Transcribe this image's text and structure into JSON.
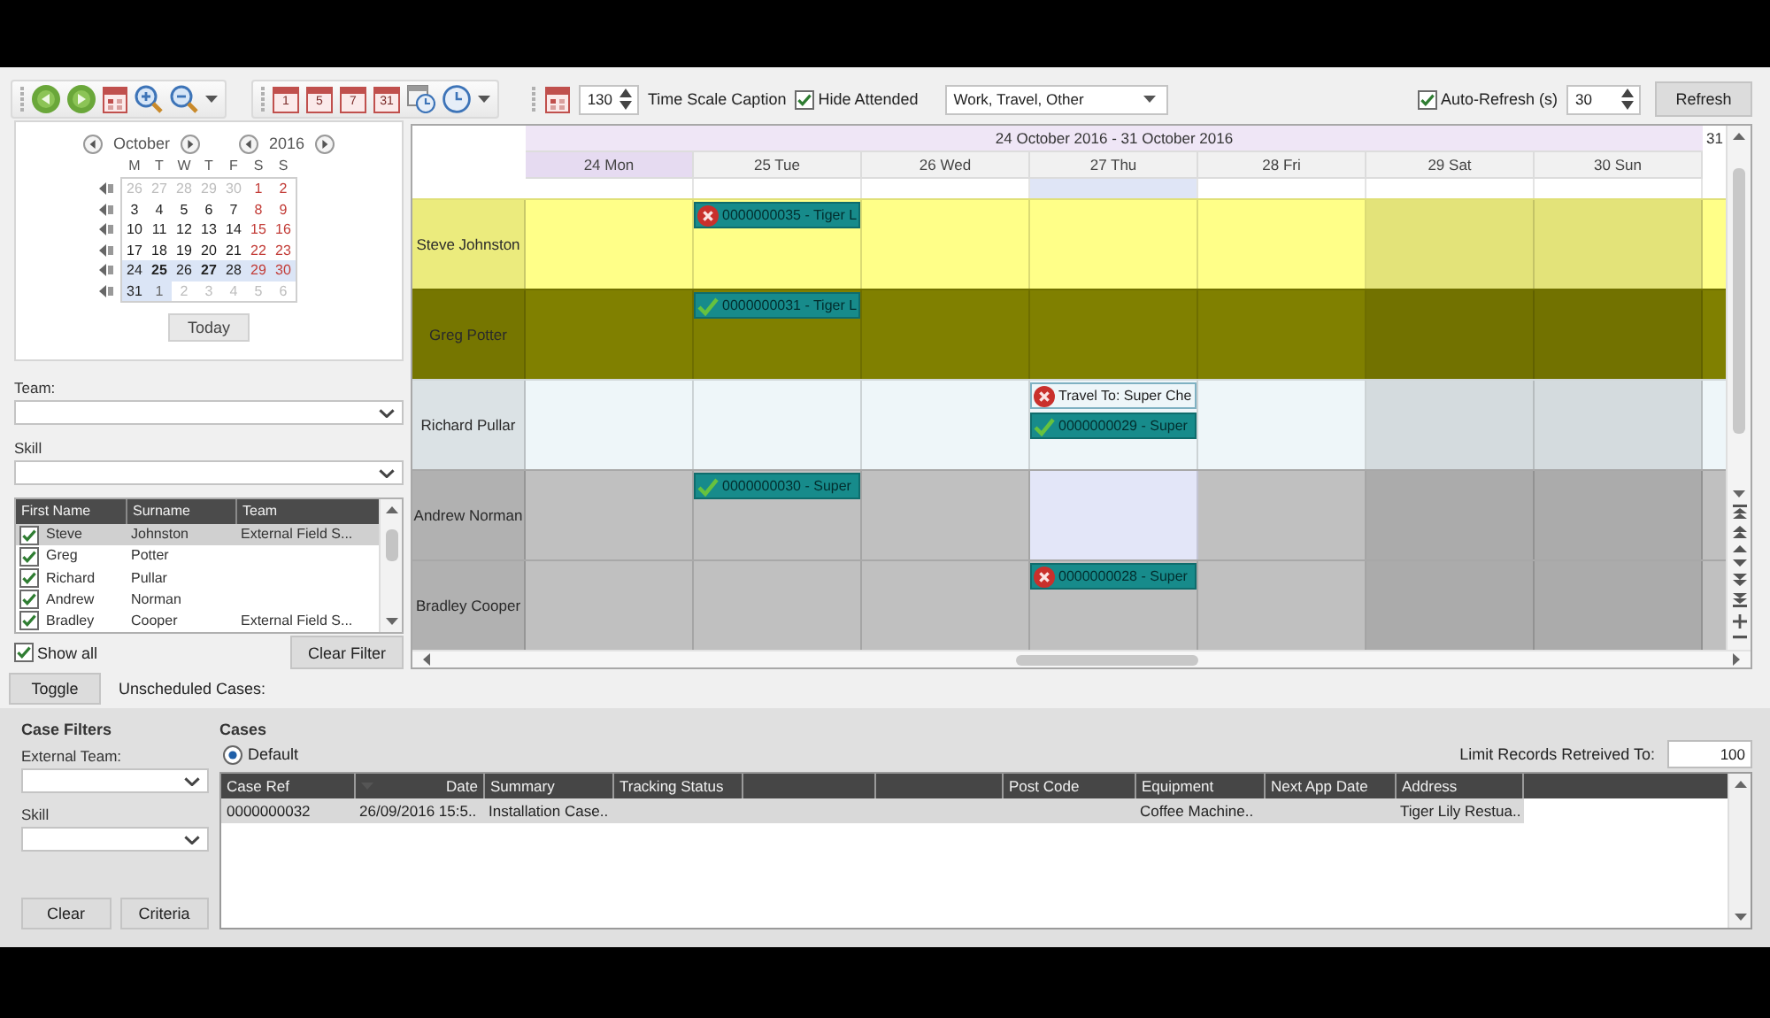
{
  "toolbar": {
    "view_buttons": [
      "1",
      "5",
      "7",
      "31"
    ],
    "scale": {
      "value": "130"
    },
    "time_scale_caption": "Time Scale Caption",
    "hide_attended": {
      "label": "Hide Attended",
      "checked": true
    },
    "appointment_types": {
      "value": "Work, Travel, Other"
    },
    "auto_refresh": {
      "label": "Auto-Refresh (s)",
      "checked": true
    },
    "refresh_interval": {
      "value": "30"
    },
    "refresh_button": "Refresh"
  },
  "calendar": {
    "month": "October",
    "year": "2016",
    "weekdays": [
      "M",
      "T",
      "W",
      "T",
      "F",
      "S",
      "S"
    ],
    "days": [
      {
        "text": "26",
        "kind": "other",
        "selected": false,
        "bold": false
      },
      {
        "text": "27",
        "kind": "other",
        "selected": false,
        "bold": false
      },
      {
        "text": "28",
        "kind": "other",
        "selected": false,
        "bold": false
      },
      {
        "text": "29",
        "kind": "other",
        "selected": false,
        "bold": false
      },
      {
        "text": "30",
        "kind": "other",
        "selected": false,
        "bold": false
      },
      {
        "text": "1",
        "kind": "weekend",
        "selected": false,
        "bold": false
      },
      {
        "text": "2",
        "kind": "weekend",
        "selected": false,
        "bold": false
      },
      {
        "text": "3",
        "kind": "weekday",
        "selected": false,
        "bold": false
      },
      {
        "text": "4",
        "kind": "weekday",
        "selected": false,
        "bold": false
      },
      {
        "text": "5",
        "kind": "weekday",
        "selected": false,
        "bold": false
      },
      {
        "text": "6",
        "kind": "weekday",
        "selected": false,
        "bold": false
      },
      {
        "text": "7",
        "kind": "weekday",
        "selected": false,
        "bold": false
      },
      {
        "text": "8",
        "kind": "weekend",
        "selected": false,
        "bold": false
      },
      {
        "text": "9",
        "kind": "weekend",
        "selected": false,
        "bold": false
      },
      {
        "text": "10",
        "kind": "weekday",
        "selected": false,
        "bold": false
      },
      {
        "text": "11",
        "kind": "weekday",
        "selected": false,
        "bold": false
      },
      {
        "text": "12",
        "kind": "weekday",
        "selected": false,
        "bold": false
      },
      {
        "text": "13",
        "kind": "weekday",
        "selected": false,
        "bold": false
      },
      {
        "text": "14",
        "kind": "weekday",
        "selected": false,
        "bold": false
      },
      {
        "text": "15",
        "kind": "weekend",
        "selected": false,
        "bold": false
      },
      {
        "text": "16",
        "kind": "weekend",
        "selected": false,
        "bold": false
      },
      {
        "text": "17",
        "kind": "weekday",
        "selected": false,
        "bold": false
      },
      {
        "text": "18",
        "kind": "weekday",
        "selected": false,
        "bold": false
      },
      {
        "text": "19",
        "kind": "weekday",
        "selected": false,
        "bold": false
      },
      {
        "text": "20",
        "kind": "weekday",
        "selected": false,
        "bold": false
      },
      {
        "text": "21",
        "kind": "weekday",
        "selected": false,
        "bold": false
      },
      {
        "text": "22",
        "kind": "weekend",
        "selected": false,
        "bold": false
      },
      {
        "text": "23",
        "kind": "weekend",
        "selected": false,
        "bold": false
      },
      {
        "text": "24",
        "kind": "weekday",
        "selected": true,
        "bold": false
      },
      {
        "text": "25",
        "kind": "weekday",
        "selected": true,
        "bold": true
      },
      {
        "text": "26",
        "kind": "weekday",
        "selected": true,
        "bold": false
      },
      {
        "text": "27",
        "kind": "weekday",
        "selected": true,
        "bold": true
      },
      {
        "text": "28",
        "kind": "weekday",
        "selected": true,
        "bold": false
      },
      {
        "text": "29",
        "kind": "weekend",
        "selected": true,
        "bold": false
      },
      {
        "text": "30",
        "kind": "weekend",
        "selected": true,
        "bold": false
      },
      {
        "text": "31",
        "kind": "weekday",
        "selected": true,
        "bold": false
      },
      {
        "text": "1",
        "kind": "other",
        "selected": true,
        "bold": false
      },
      {
        "text": "2",
        "kind": "other",
        "selected": false,
        "bold": false
      },
      {
        "text": "3",
        "kind": "other",
        "selected": false,
        "bold": false
      },
      {
        "text": "4",
        "kind": "other",
        "selected": false,
        "bold": false
      },
      {
        "text": "5",
        "kind": "other",
        "selected": false,
        "bold": false
      },
      {
        "text": "6",
        "kind": "other",
        "selected": false,
        "bold": false
      }
    ],
    "today_button": "Today"
  },
  "filters": {
    "team": {
      "label": "Team:"
    },
    "skill": {
      "label": "Skill"
    }
  },
  "staff": {
    "columns": [
      "First Name",
      "Surname",
      "Team"
    ],
    "rows": [
      {
        "first_name": "Steve",
        "surname": "Johnston",
        "team": "External Field S...",
        "checked": true,
        "selected": true
      },
      {
        "first_name": "Greg",
        "surname": "Potter",
        "checked": true,
        "selected": false
      },
      {
        "first_name": "Richard",
        "surname": "Pullar",
        "checked": true,
        "selected": false
      },
      {
        "first_name": "Andrew",
        "surname": "Norman",
        "checked": true,
        "selected": false
      },
      {
        "first_name": "Bradley",
        "surname": "Cooper",
        "team": "External Field S...",
        "checked": true,
        "selected": false
      }
    ],
    "show_all": {
      "label": "Show all",
      "checked": true
    },
    "clear_filter_button": "Clear Filter"
  },
  "schedule": {
    "date_range": "24 October 2016 - 31 October 2016",
    "next_day": "31",
    "days": [
      {
        "label": "24 Mon",
        "current": true,
        "weekend": false,
        "selected": false
      },
      {
        "label": "25 Tue",
        "current": false,
        "weekend": false,
        "selected": false
      },
      {
        "label": "26 Wed",
        "current": false,
        "weekend": false,
        "selected": false
      },
      {
        "label": "27 Thu",
        "current": false,
        "weekend": false,
        "selected": true
      },
      {
        "label": "28 Fri",
        "current": false,
        "weekend": false,
        "selected": false
      },
      {
        "label": "29 Sat",
        "current": false,
        "weekend": true,
        "selected": false
      },
      {
        "label": "30 Sun",
        "current": false,
        "weekend": true,
        "selected": false
      }
    ],
    "resources": [
      {
        "name": "Steve Johnston",
        "color": "#ffff88",
        "cells": [
          {
            "selected": false
          },
          {
            "selected": false,
            "events": [
              {
                "kind": "job",
                "text": "0000000035 - Tiger L",
                "completed": false
              }
            ]
          },
          {
            "selected": false
          },
          {
            "selected": false
          },
          {
            "selected": false
          },
          {
            "selected": false
          },
          {
            "selected": false
          }
        ]
      },
      {
        "name": "Greg Potter",
        "color": "#808000",
        "cells": [
          {
            "selected": false
          },
          {
            "selected": false,
            "events": [
              {
                "kind": "job",
                "text": "0000000031 - Tiger L",
                "completed": true
              }
            ]
          },
          {
            "selected": false
          },
          {
            "selected": false
          },
          {
            "selected": false
          },
          {
            "selected": false
          },
          {
            "selected": false
          }
        ]
      },
      {
        "name": "Richard Pullar",
        "color": "#eef6f9",
        "cells": [
          {
            "selected": false
          },
          {
            "selected": false
          },
          {
            "selected": false
          },
          {
            "selected": false,
            "events": [
              {
                "kind": "travel",
                "text": "Travel To: Super Che",
                "completed": false
              },
              {
                "kind": "job",
                "text": "0000000029 - Super",
                "completed": true
              }
            ]
          },
          {
            "selected": false
          },
          {
            "selected": false
          },
          {
            "selected": false
          }
        ]
      },
      {
        "name": "Andrew Norman",
        "color": "#c0c0c0",
        "cells": [
          {
            "selected": false
          },
          {
            "selected": false,
            "events": [
              {
                "kind": "job",
                "text": "0000000030 - Super",
                "completed": true
              }
            ]
          },
          {
            "selected": false
          },
          {
            "selected": true
          },
          {
            "selected": false
          },
          {
            "selected": false
          },
          {
            "selected": false
          }
        ]
      },
      {
        "name": "Bradley Cooper",
        "color": "#c0c0c0",
        "cells": [
          {
            "selected": false
          },
          {
            "selected": false
          },
          {
            "selected": false
          },
          {
            "selected": false,
            "events": [
              {
                "kind": "job",
                "text": "0000000028 - Super",
                "completed": false
              }
            ]
          },
          {
            "selected": false
          },
          {
            "selected": false
          },
          {
            "selected": false
          }
        ]
      }
    ]
  },
  "unscheduled": {
    "toggle_button": "Toggle",
    "label": "Unscheduled Cases:"
  },
  "case_filters": {
    "title": "Case Filters",
    "external_team": {
      "label": "External Team:"
    },
    "skill": {
      "label": "Skill"
    },
    "buttons": [
      "Clear",
      "Criteria"
    ]
  },
  "cases": {
    "title": "Cases",
    "default_view": {
      "label": "Default",
      "selected": true
    },
    "limit": {
      "label": "Limit Records Retreived To:",
      "value": "100"
    },
    "columns": [
      {
        "kind": "text",
        "label": "Case Ref"
      },
      {
        "kind": "menu",
        "label": "Date"
      },
      {
        "kind": "text",
        "label": "Summary"
      },
      {
        "kind": "text",
        "label": "Tracking Status"
      },
      {
        "kind": "blank"
      },
      {
        "kind": "blank"
      },
      {
        "kind": "text",
        "label": "Post Code"
      },
      {
        "kind": "text",
        "label": "Equipment"
      },
      {
        "kind": "text",
        "label": "Next App Date"
      },
      {
        "kind": "text",
        "label": "Address"
      }
    ],
    "rows": [
      {
        "selected": true,
        "cells": [
          "0000000032",
          "26/09/2016  15:5..",
          "Installation Case..",
          null,
          null,
          null,
          null,
          "Coffee Machine..",
          null,
          "Tiger Lily Restua.."
        ]
      }
    ]
  }
}
